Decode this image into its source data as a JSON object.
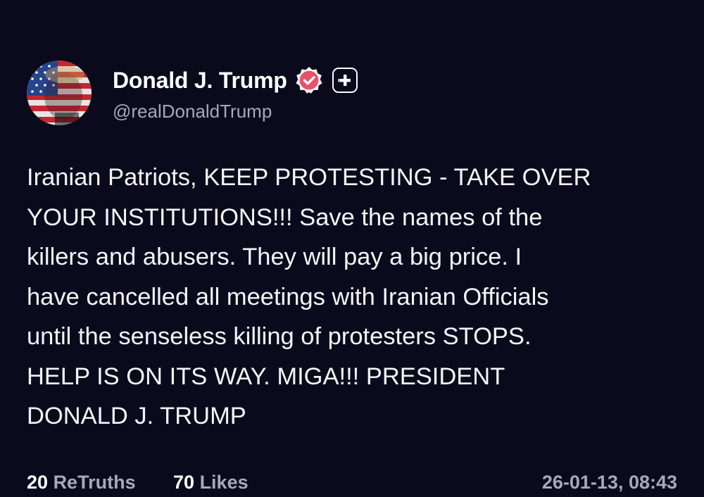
{
  "author": {
    "display_name": "Donald J. Trump",
    "handle": "@realDonaldTrump",
    "avatar_icon": "avatar-flag-portrait",
    "verified_icon": "verified-badge-icon",
    "follow_icon": "plus-icon"
  },
  "post": {
    "lines": [
      "Iranian Patriots, KEEP PROTESTING - TAKE OVER",
      "YOUR INSTITUTIONS!!! Save the names of the",
      "killers and abusers. They will pay a big price. I",
      "have cancelled all meetings with Iranian Officials",
      "until the senseless killing of protesters STOPS.",
      "HELP IS ON ITS WAY. MIGA!!! PRESIDENT",
      "DONALD J. TRUMP"
    ]
  },
  "footer": {
    "retruths_count": "20",
    "retruths_label": "ReTruths",
    "likes_count": "70",
    "likes_label": "Likes",
    "timestamp": "26-01-13, 08:43"
  },
  "colors": {
    "background": "#0b0a1d",
    "text": "#f4f4f7",
    "muted": "#a9a8b6",
    "verified_badge": "#e8536a"
  }
}
